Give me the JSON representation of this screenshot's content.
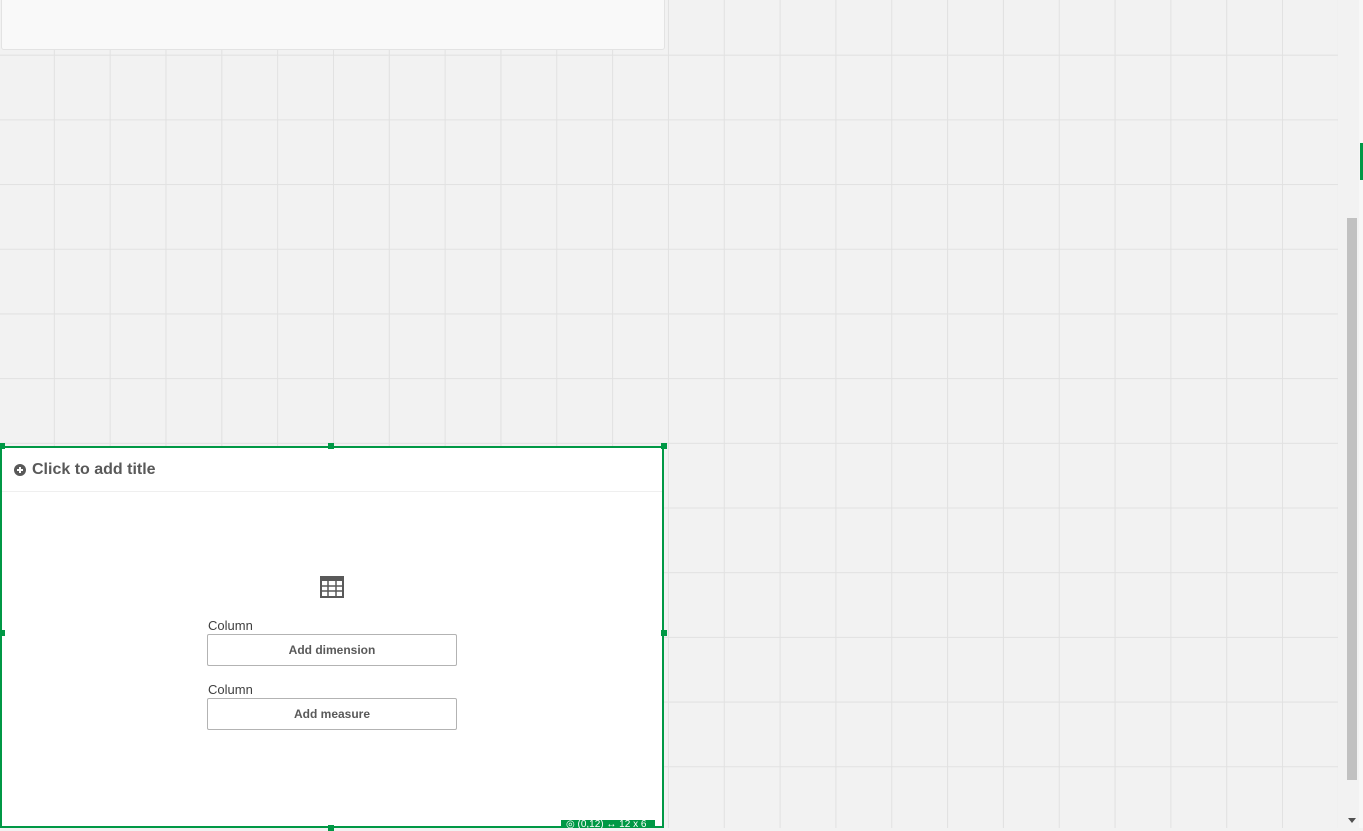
{
  "table_object": {
    "title_placeholder": "Click to add title",
    "dimension_label": "Column",
    "dimension_button": "Add dimension",
    "measure_label": "Column",
    "measure_button": "Add measure",
    "status": "◎ (0,12)  ↔ 12 x 6"
  },
  "icons": {
    "title_add": "plus-circle-icon",
    "placeholder": "table-icon",
    "scroll_down": "chevron-down-icon"
  },
  "colors": {
    "accent": "#009845",
    "canvas": "#f2f2f2",
    "grid_line": "#e1e1e1",
    "text": "#595959"
  }
}
